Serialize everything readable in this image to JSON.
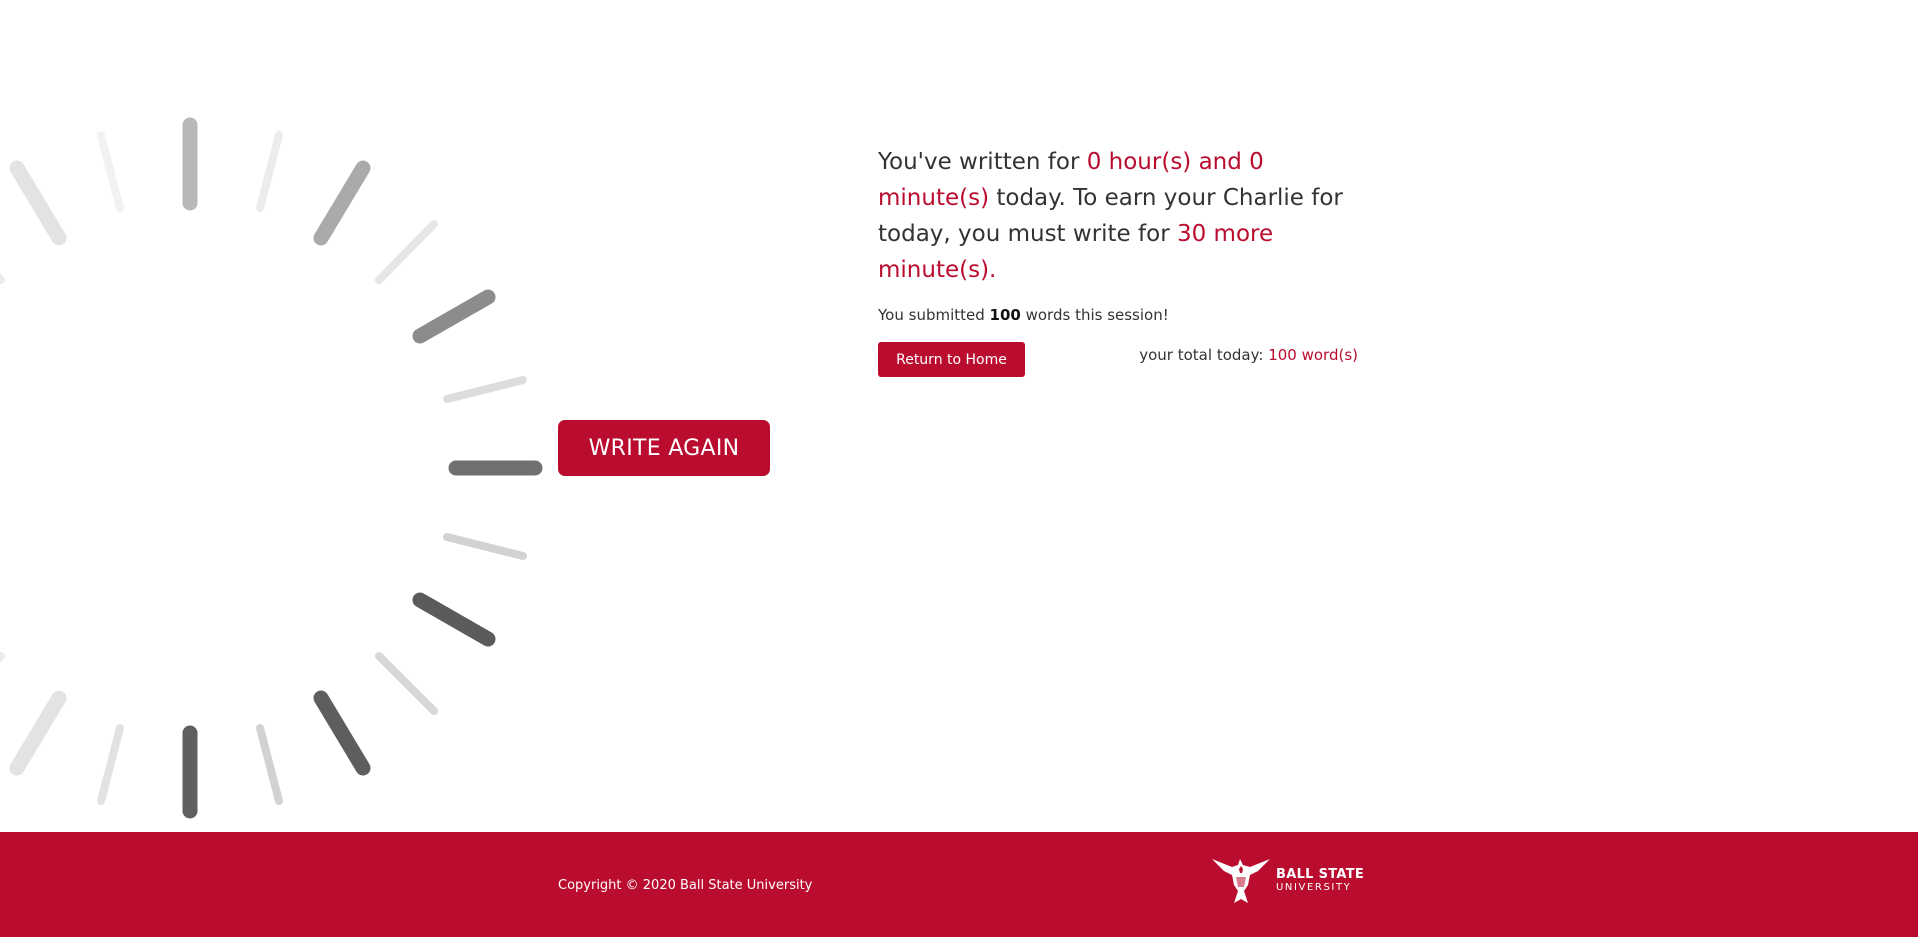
{
  "main": {
    "write_again_label": "WRITE AGAIN",
    "headline": {
      "prefix": "You've written for ",
      "time_written": "0 hour(s) and 0 minute(s)",
      "middle": " today. To earn your Charlie for today, you must write for ",
      "time_remaining": "30 more minute(s).",
      "suffix": ""
    },
    "words": {
      "prefix": "You submitted ",
      "count": "100",
      "suffix": " words this session!"
    },
    "return_home_label": "Return to Home",
    "total": {
      "label": "your total today: ",
      "value": "100 word(s)"
    }
  },
  "footer": {
    "copyright": "Copyright © 2020 Ball State University",
    "logo_line1": "BALL STATE",
    "logo_line2": "UNIVERSITY",
    "logo_icon": "cardinal-icon"
  },
  "colors": {
    "brand_red": "#ba0c2f",
    "text_dark": "#333333",
    "white": "#ffffff"
  },
  "clock": {
    "icon": "loading-spinner-icon"
  }
}
